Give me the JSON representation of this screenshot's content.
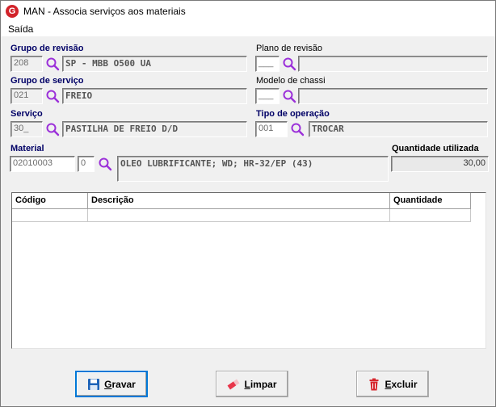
{
  "window": {
    "title": "MAN - Associa serviços aos materiais",
    "app_icon_letter": "G"
  },
  "menu": {
    "items": [
      "Saída"
    ]
  },
  "form": {
    "grupo_revisao": {
      "label": "Grupo de revisão",
      "code": "208",
      "desc": "SP - MBB O500 UA"
    },
    "plano_revisao": {
      "label": "Plano de revisão",
      "code": "___",
      "desc": ""
    },
    "grupo_servico": {
      "label": "Grupo de serviço",
      "code": "021",
      "desc": "FREIO"
    },
    "modelo_chassi": {
      "label": "Modelo de chassi",
      "code": "___",
      "desc": ""
    },
    "servico": {
      "label": "Serviço",
      "code": "30_",
      "desc": "PASTILHA DE FREIO D/D"
    },
    "tipo_operacao": {
      "label": "Tipo de operação",
      "code": "001",
      "desc": "TROCAR"
    },
    "material": {
      "label": "Material",
      "code": "02010003",
      "digit": "0",
      "desc": "OLEO LUBRIFICANTE; WD; HR-32/EP (43)"
    },
    "quantidade": {
      "label": "Quantidade utilizada",
      "value": "30,00"
    }
  },
  "grid": {
    "columns": [
      "Código",
      "Descrição",
      "Quantidade"
    ]
  },
  "buttons": {
    "gravar": {
      "pre": "",
      "accel": "G",
      "post": "ravar"
    },
    "limpar": {
      "pre": "",
      "accel": "L",
      "post": "impar"
    },
    "excluir": {
      "pre": "",
      "accel": "E",
      "post": "xcluir"
    }
  },
  "colors": {
    "label_blue": "#000066",
    "search_purple": "#9b30d9",
    "focus_blue": "#0078d7",
    "app_red": "#d2232a"
  }
}
